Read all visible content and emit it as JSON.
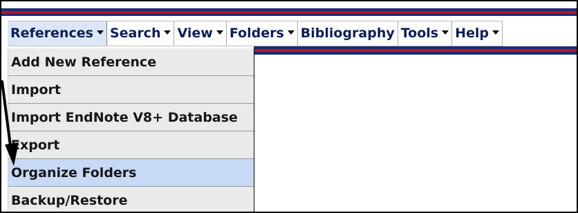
{
  "menubar": {
    "items": [
      {
        "label": "References",
        "has_caret": true,
        "active": true
      },
      {
        "label": "Search",
        "has_caret": true,
        "active": false
      },
      {
        "label": "View",
        "has_caret": true,
        "active": false
      },
      {
        "label": "Folders",
        "has_caret": true,
        "active": false
      },
      {
        "label": "Bibliography",
        "has_caret": false,
        "active": false
      },
      {
        "label": "Tools",
        "has_caret": true,
        "active": false
      },
      {
        "label": "Help",
        "has_caret": true,
        "active": false
      }
    ]
  },
  "dropdown": {
    "items": [
      {
        "label": "Add New Reference"
      },
      {
        "label": "Import"
      },
      {
        "label": "Import EndNote V8+ Database"
      },
      {
        "label": "Export"
      },
      {
        "label": "Organize Folders",
        "highlighted": true
      },
      {
        "label": "Backup/Restore"
      }
    ]
  },
  "colors": {
    "banner_navy": "#1c2a78",
    "banner_red": "#c01515",
    "menu_text": "#0d1e56",
    "highlight": "#c8d9f5",
    "dropdown_bg": "#eaeaea"
  },
  "annotation": {
    "arrow_icon": "black-pointer-arrow"
  }
}
